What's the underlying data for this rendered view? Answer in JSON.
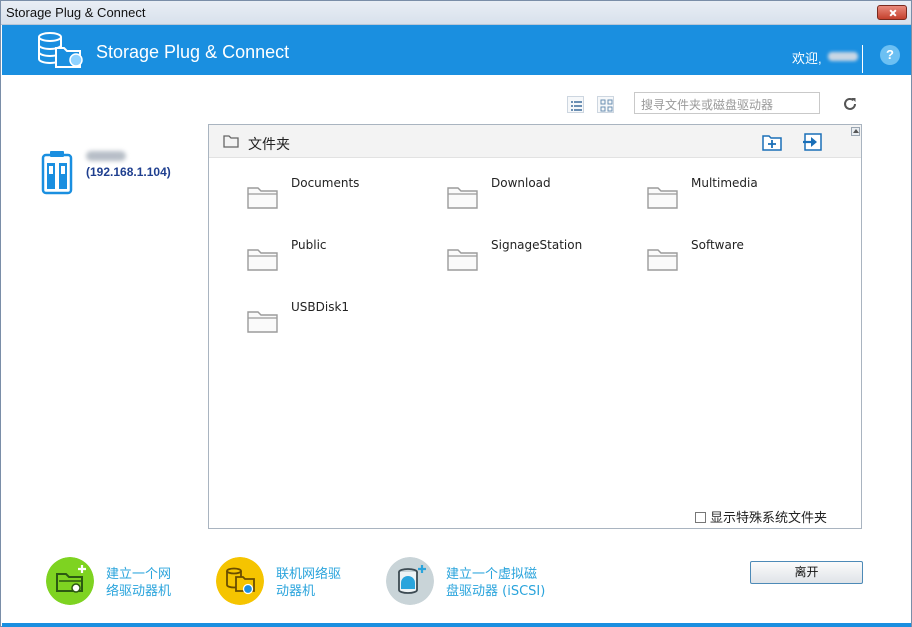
{
  "window": {
    "title": "Storage Plug & Connect",
    "close_label": ""
  },
  "header": {
    "app_title": "Storage Plug & Connect",
    "welcome": "欢迎,",
    "help_label": "?",
    "brand_color": "#1a8fe0"
  },
  "toolbar": {
    "list_view_icon": "list-view-icon",
    "grid_view_icon": "grid-view-icon",
    "search_placeholder": "搜寻文件夹或磁盘驱动器",
    "refresh_icon": "refresh-icon"
  },
  "device": {
    "ip": "(192.168.1.104)",
    "icon": "nas-device-icon"
  },
  "panel": {
    "title": "文件夹",
    "folders": [
      {
        "name": "Documents"
      },
      {
        "name": "Download"
      },
      {
        "name": "Multimedia"
      },
      {
        "name": "Public"
      },
      {
        "name": "SignageStation"
      },
      {
        "name": "Software"
      },
      {
        "name": "USBDisk1"
      }
    ],
    "show_system_label": "显示特殊系统文件夹",
    "show_system_checked": false
  },
  "actions": [
    {
      "line1": "建立一个网",
      "line2": "络驱动器机",
      "color": "#7ed321"
    },
    {
      "line1": "联机网络驱",
      "line2": "动器机",
      "color": "#f5c400"
    },
    {
      "line1": "建立一个虚拟磁",
      "line2": "盘驱动器 (iSCSI)",
      "color": "#c9d4d8"
    }
  ],
  "leave_label": "离开"
}
